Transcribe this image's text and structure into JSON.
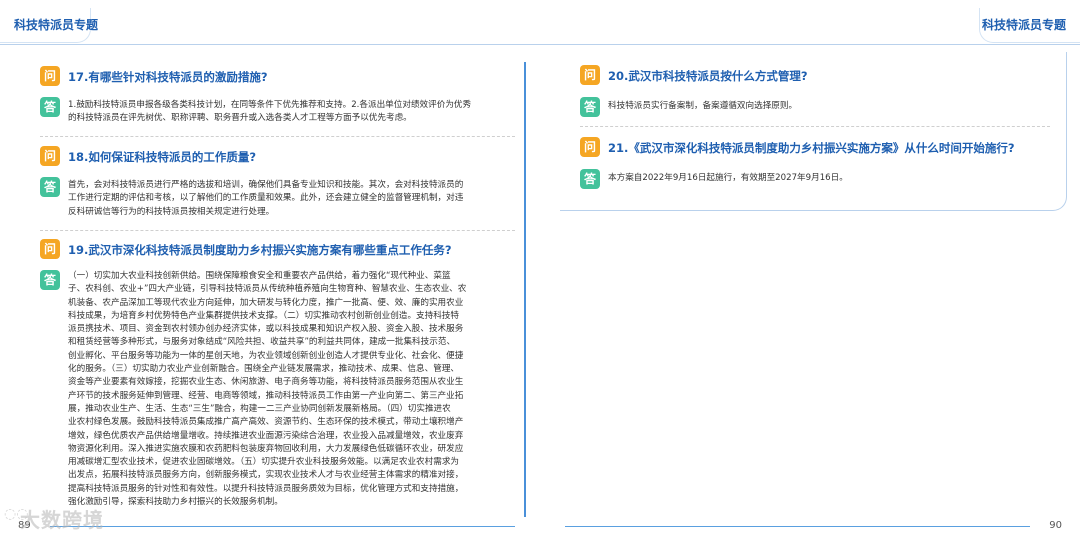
{
  "header": {
    "left_title": "科技特派员专题",
    "right_title": "科技特派员专题"
  },
  "badges": {
    "question": "问",
    "answer": "答"
  },
  "qa": [
    {
      "question": "17.有哪些针对科技特派员的激励措施?",
      "answer_lines": [
        "1.鼓励科技特派员申报各级各类科技计划，在同等条件下优先推荐和支持。2.各派出单位对绩效评价为优秀",
        "的科技特派员在评先树优、职称评聘、职务晋升或入选各类人才工程等方面予以优先考虑。"
      ]
    },
    {
      "question": "18.如何保证科技特派员的工作质量?",
      "answer_lines": [
        "首先，会对科技特派员进行严格的选拔和培训，确保他们具备专业知识和技能。其次，会对科技特派员的",
        "工作进行定期的评估和考核，以了解他们的工作质量和效果。此外，还会建立健全的监督管理机制，对违",
        "反科研诚信等行为的科技特派员按相关规定进行处理。"
      ]
    },
    {
      "question": "19.武汉市深化科技特派员制度助力乡村振兴实施方案有哪些重点工作任务?",
      "answer_lines": [
        "（一）切实加大农业科技创新供给。围绕保障粮食安全和重要农产品供给，着力强化“现代种业、菜篮",
        "子、农科创、农业+”四大产业链，引导科技特派员从传统种植养殖向生物育种、智慧农业、生态农业、农",
        "机装备、农产品深加工等现代农业方向延伸，加大研发与转化力度，推广一批高、便、效、廉的实用农业",
        "科技成果，为培育乡村优势特色产业集群提供技术支撑。（二）切实推动农村创新创业创造。支持科技特",
        "派员携技术、项目、资金到农村领办创办经济实体，或以科技成果和知识产权入股、资金入股、技术服务",
        "和租赁经营等多种形式，与服务对象结成“风险共担、收益共享”的利益共同体，建成一批集科技示范、",
        "创业孵化、平台服务等功能为一体的星创天地，为农业领域创新创业创造人才提供专业化、社会化、便捷",
        "化的服务。（三）切实助力农业产业创新融合。围绕全产业链发展需求，推动技术、成果、信息、管理、",
        "资金等产业要素有效嫁接，挖掘农业生态、休闲旅游、电子商务等功能，将科技特派员服务范围从农业生",
        "产环节的技术服务延伸到管理、经营、电商等领域，推动科技特派员工作由第一产业向第二、第三产业拓",
        "展，推动农业生产、生活、生态“三生”融合，构建一二三产业协同创新发展新格局。（四）切实推进农",
        "业农村绿色发展。鼓励科技特派员集成推广高产高效、资源节约、生态环保的技术模式，带动土壤积增产",
        "增效，绿色优质农产品供给增量增收。持续推进农业面源污染综合治理，农业投入品减量增效，农业废弃",
        "物资源化利用。深入推进实施农膜和农药肥料包装废弃物回收利用，大力发展绿色低碳循环农业，研发应",
        "用减碳增汇型农业技术，促进农业固碳增效。（五）切实提升农业科技服务效能。以满足农业农村需求为",
        "出发点，拓展科技特派员服务方向，创新服务模式，实现农业技术人才与农业经营主体需求的精准对接，",
        "提高科技特派员服务的针对性和有效性。以提升科技特派员服务质效为目标，优化管理方式和支持措施，",
        "强化激励引导，探索科技助力乡村振兴的长效服务机制。"
      ]
    },
    {
      "question": "20.武汉市科技特派员按什么方式管理?",
      "answer_lines": [
        "科技特派员实行备案制，备案遵循双向选择原则。"
      ]
    },
    {
      "question": "21.《武汉市深化科技特派员制度助力乡村振兴实施方案》从什么时间开始施行?",
      "answer_lines": [
        "本方案自2022年9月16日起施行，有效期至2027年9月16日。"
      ]
    }
  ],
  "footer": {
    "left_page": "89",
    "right_page": "90",
    "watermark": "大数跨境"
  }
}
